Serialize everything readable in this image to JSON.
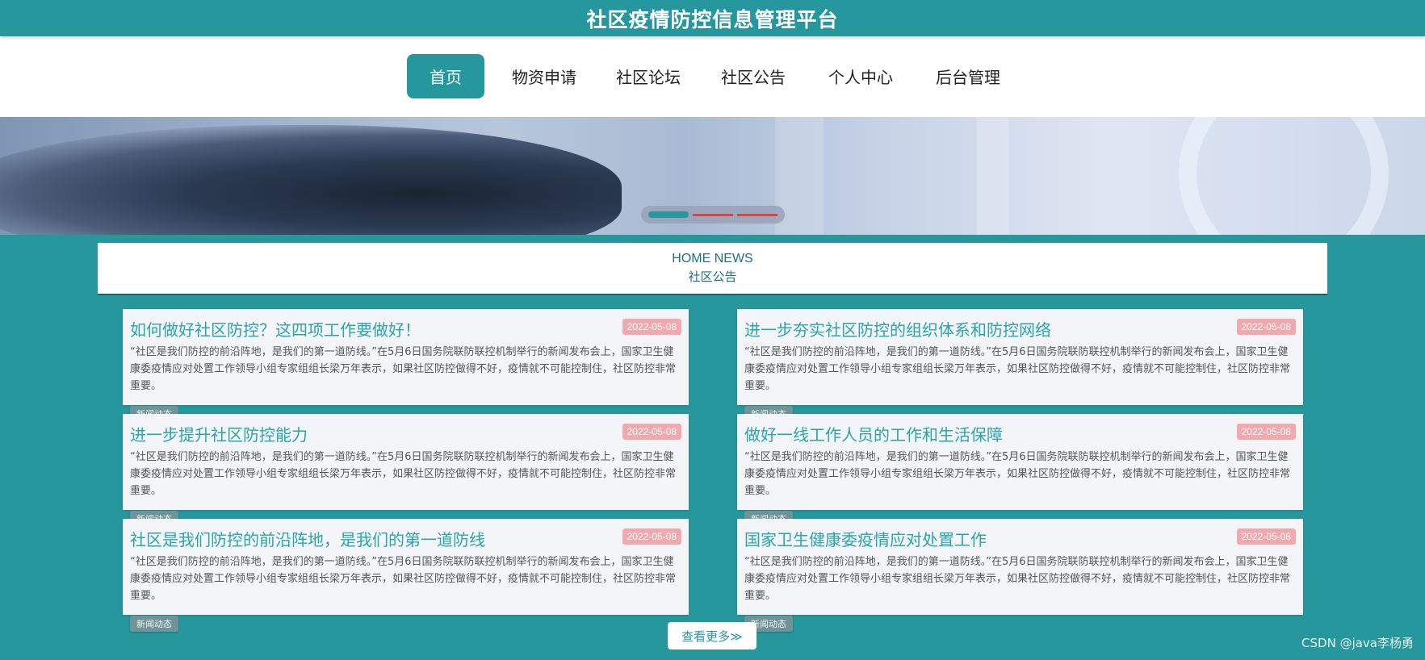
{
  "header": {
    "title": "社区疫情防控信息管理平台"
  },
  "nav": {
    "items": [
      {
        "label": "首页",
        "active": true
      },
      {
        "label": "物资申请"
      },
      {
        "label": "社区论坛"
      },
      {
        "label": "社区公告"
      },
      {
        "label": "个人中心"
      },
      {
        "label": "后台管理"
      }
    ]
  },
  "section": {
    "en": "HOME NEWS",
    "cn": "社区公告"
  },
  "news": [
    {
      "title": "如何做好社区防控？这四项工作要做好！",
      "date": "2022-05-08",
      "body": "“社区是我们防控的前沿阵地，是我们的第一道防线。”在5月6日国务院联防联控机制举行的新闻发布会上，国家卫生健康委疫情应对处置工作领导小组专家组组长梁万年表示，如果社区防控做得不好，疫情就不可能控制住，社区防控非常重要。",
      "tag": "新闻动态"
    },
    {
      "title": "进一步夯实社区防控的组织体系和防控网络",
      "date": "2022-05-08",
      "body": "“社区是我们防控的前沿阵地，是我们的第一道防线。”在5月6日国务院联防联控机制举行的新闻发布会上，国家卫生健康委疫情应对处置工作领导小组专家组组长梁万年表示，如果社区防控做得不好，疫情就不可能控制住，社区防控非常重要。",
      "tag": "新闻动态"
    },
    {
      "title": "进一步提升社区防控能力",
      "date": "2022-05-08",
      "body": "“社区是我们防控的前沿阵地，是我们的第一道防线。”在5月6日国务院联防联控机制举行的新闻发布会上，国家卫生健康委疫情应对处置工作领导小组专家组组长梁万年表示，如果社区防控做得不好，疫情就不可能控制住，社区防控非常重要。",
      "tag": "新闻动态"
    },
    {
      "title": "做好一线工作人员的工作和生活保障",
      "date": "2022-05-08",
      "body": "“社区是我们防控的前沿阵地，是我们的第一道防线。”在5月6日国务院联防联控机制举行的新闻发布会上，国家卫生健康委疫情应对处置工作领导小组专家组组长梁万年表示，如果社区防控做得不好，疫情就不可能控制住，社区防控非常重要。",
      "tag": "新闻动态"
    },
    {
      "title": "社区是我们防控的前沿阵地，是我们的第一道防线",
      "date": "2022-05-08",
      "body": "“社区是我们防控的前沿阵地，是我们的第一道防线。”在5月6日国务院联防联控机制举行的新闻发布会上，国家卫生健康委疫情应对处置工作领导小组专家组组长梁万年表示，如果社区防控做得不好，疫情就不可能控制住，社区防控非常重要。",
      "tag": "新闻动态"
    },
    {
      "title": "国家卫生健康委疫情应对处置工作",
      "date": "2022-05-08",
      "body": "“社区是我们防控的前沿阵地，是我们的第一道防线。”在5月6日国务院联防联控机制举行的新闻发布会上，国家卫生健康委疫情应对处置工作领导小组专家组组长梁万年表示，如果社区防控做得不好，疫情就不可能控制住，社区防控非常重要。",
      "tag": "新闻动态"
    }
  ],
  "more_label": "查看更多≫",
  "watermark": "CSDN @java李杨勇",
  "colors": {
    "primary": "#26989d",
    "title_text": "#29a6ab",
    "date_badge": "#f2a9ae",
    "tag_bg": "#6f9497"
  }
}
